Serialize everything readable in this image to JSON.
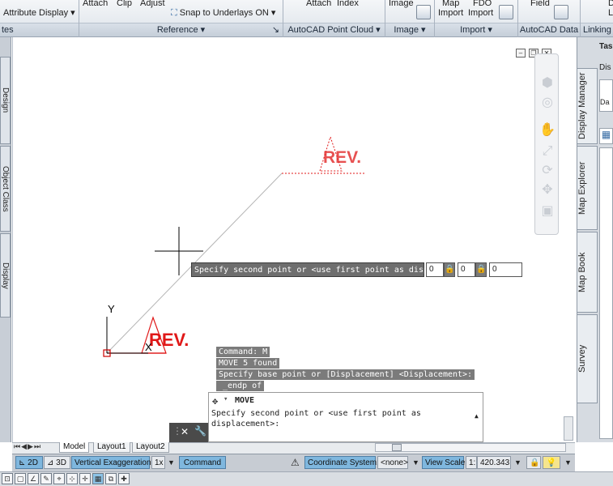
{
  "ribbon": {
    "attribute_display": "Attribute Display",
    "attach": "Attach",
    "clip": "Clip",
    "adjust": "Adjust",
    "snap_to_underlays": "Snap to Underlays ON",
    "attach2": "Attach",
    "index": "Index",
    "image": "Image",
    "map": "Map",
    "map_import": "Import",
    "fdo": "FDO",
    "fdo_import": "Import",
    "field": "Field",
    "right_d": "D",
    "right_l": "L",
    "groups": {
      "tes": "tes",
      "reference": "Reference",
      "point_cloud": "AutoCAD Point Cloud",
      "image": "Image",
      "import": "Import",
      "autocad_data": "AutoCAD Data",
      "linking": "Linking"
    }
  },
  "left_palette": {
    "tabs": [
      "Design",
      "Object Class",
      "Display"
    ]
  },
  "drawing": {
    "rev_label_top": "REV.",
    "rev_label_bottom": "REV.",
    "ucs_x": "X",
    "ucs_y": "Y"
  },
  "dynamic_input": {
    "prompt": "Specify second point or <use first point as displacement>:",
    "field1": "0",
    "field2": "0",
    "field3": "0"
  },
  "command_history": [
    "Command: M",
    "MOVE 5 found",
    "Specify base point or [Displacement] <Displacement>:",
    "_endp of"
  ],
  "command_window": {
    "command_name": "MOVE",
    "prompt_line1": "Specify second point or <use first point as",
    "prompt_line2": "displacement>:"
  },
  "right_palette": {
    "title": "Tas",
    "header": "Dis",
    "item": "Da",
    "tabs": [
      "Display Manager",
      "Map Explorer",
      "Map Book",
      "Survey"
    ]
  },
  "layout_tabs": [
    "Model",
    "Layout1",
    "Layout2"
  ],
  "status_bar": {
    "mode_2d": "2D",
    "mode_3d": "3D",
    "vertical_exaggeration_label": "Vertical Exaggeration:",
    "vertical_exaggeration_value": "1x",
    "command": "Command",
    "coordinate_system_label": "Coordinate System:",
    "coordinate_system_value": "<none>",
    "view_scale_label": "View Scale",
    "view_scale_value": "1:",
    "coordinate_readout": "420.343"
  },
  "colors": {
    "rev": "#e01818",
    "status_blue": "#7fb7de"
  }
}
